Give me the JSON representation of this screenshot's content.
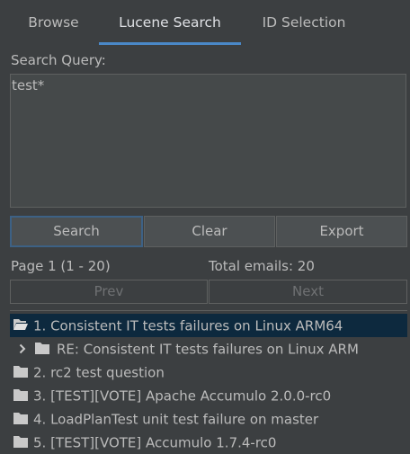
{
  "tabs": [
    {
      "label": "Browse"
    },
    {
      "label": "Lucene Search"
    },
    {
      "label": "ID Selection"
    }
  ],
  "search": {
    "label": "Search Query:",
    "value": "test*"
  },
  "buttons": {
    "search": "Search",
    "clear": "Clear",
    "export": "Export",
    "prev": "Prev",
    "next": "Next"
  },
  "paging": {
    "page": "Page 1 (1 - 20)",
    "total": "Total emails: 20"
  },
  "results": [
    {
      "text": "1. Consistent IT tests failures on Linux ARM64",
      "icon": "folder-open-icon",
      "selected": true
    },
    {
      "text": "RE: Consistent IT tests failures on Linux ARM",
      "icon": "folder-icon",
      "child": true
    },
    {
      "text": "2. rc2 test question",
      "icon": "folder-icon"
    },
    {
      "text": "3. [TEST][VOTE] Apache Accumulo 2.0.0-rc0",
      "icon": "folder-icon"
    },
    {
      "text": "4. LoadPlanTest unit test failure on master",
      "icon": "folder-icon"
    },
    {
      "text": "5. [TEST][VOTE] Accumulo 1.7.4-rc0",
      "icon": "folder-icon"
    }
  ],
  "colors": {
    "background": "#3c3f41",
    "accent": "#4a88c7",
    "selection": "#0d293e"
  }
}
